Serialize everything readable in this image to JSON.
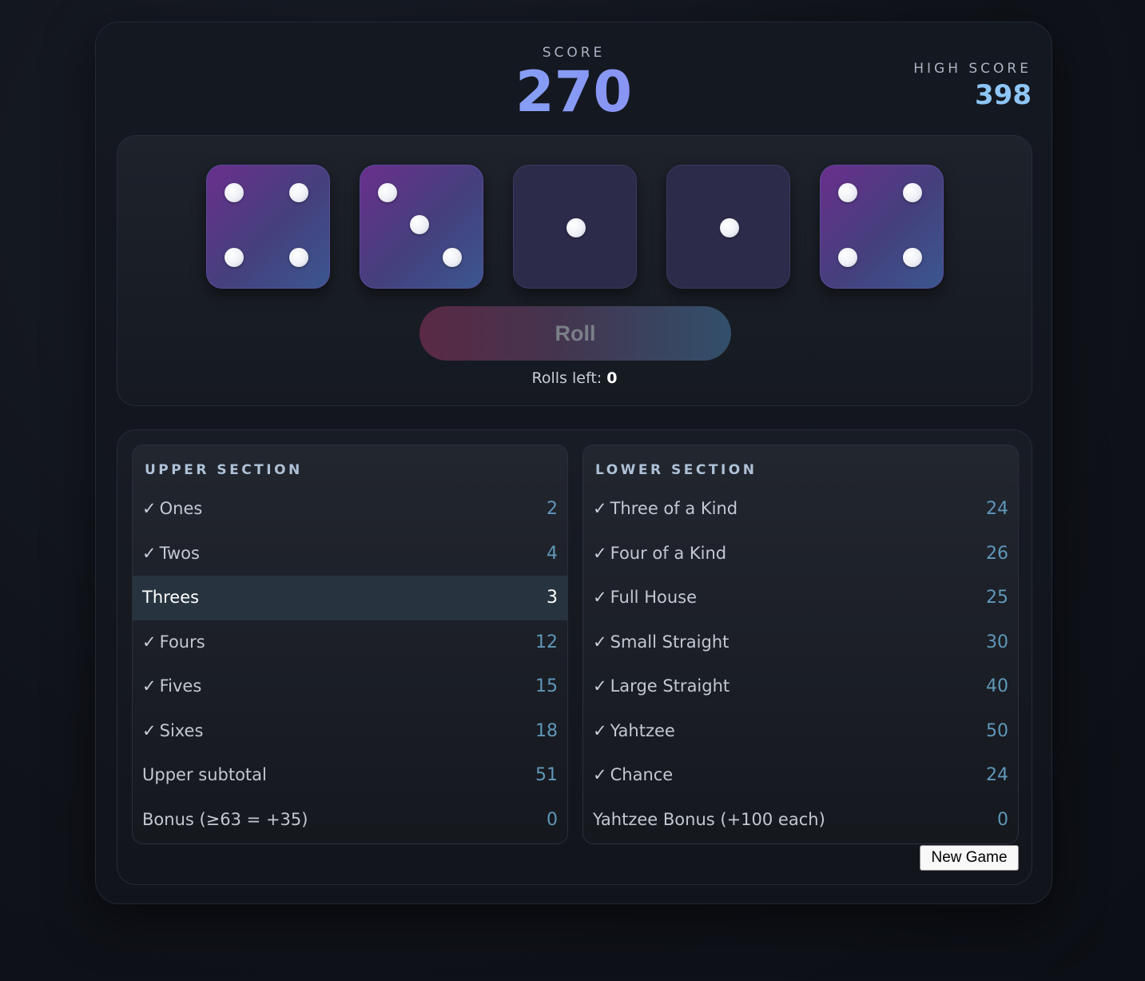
{
  "score": {
    "label": "SCORE",
    "value": "270"
  },
  "high_score": {
    "label": "HIGH SCORE",
    "value": "398"
  },
  "dice": [
    {
      "value": 4,
      "held": false
    },
    {
      "value": 3,
      "held": false
    },
    {
      "value": 1,
      "held": true
    },
    {
      "value": 1,
      "held": true
    },
    {
      "value": 4,
      "held": false
    }
  ],
  "roll": {
    "label": "Roll",
    "rolls_left_label": "Rolls left:",
    "rolls_left": "0"
  },
  "check_mark": "✓",
  "upper": {
    "title": "UPPER SECTION",
    "rows": [
      {
        "label": "Ones",
        "value": "2",
        "scored": true
      },
      {
        "label": "Twos",
        "value": "4",
        "scored": true
      },
      {
        "label": "Threes",
        "value": "3",
        "scored": false,
        "active": true
      },
      {
        "label": "Fours",
        "value": "12",
        "scored": true
      },
      {
        "label": "Fives",
        "value": "15",
        "scored": true
      },
      {
        "label": "Sixes",
        "value": "18",
        "scored": true
      }
    ],
    "subtotal": {
      "label": "Upper subtotal",
      "value": "51"
    },
    "bonus": {
      "label": "Bonus (≥63 = +35)",
      "value": "0"
    }
  },
  "lower": {
    "title": "LOWER SECTION",
    "rows": [
      {
        "label": "Three of a Kind",
        "value": "24",
        "scored": true
      },
      {
        "label": "Four of a Kind",
        "value": "26",
        "scored": true
      },
      {
        "label": "Full House",
        "value": "25",
        "scored": true
      },
      {
        "label": "Small Straight",
        "value": "30",
        "scored": true
      },
      {
        "label": "Large Straight",
        "value": "40",
        "scored": true
      },
      {
        "label": "Yahtzee",
        "value": "50",
        "scored": true
      },
      {
        "label": "Chance",
        "value": "24",
        "scored": true
      }
    ],
    "bonus": {
      "label": "Yahtzee Bonus (+100 each)",
      "value": "0"
    }
  },
  "new_game_label": "New Game"
}
